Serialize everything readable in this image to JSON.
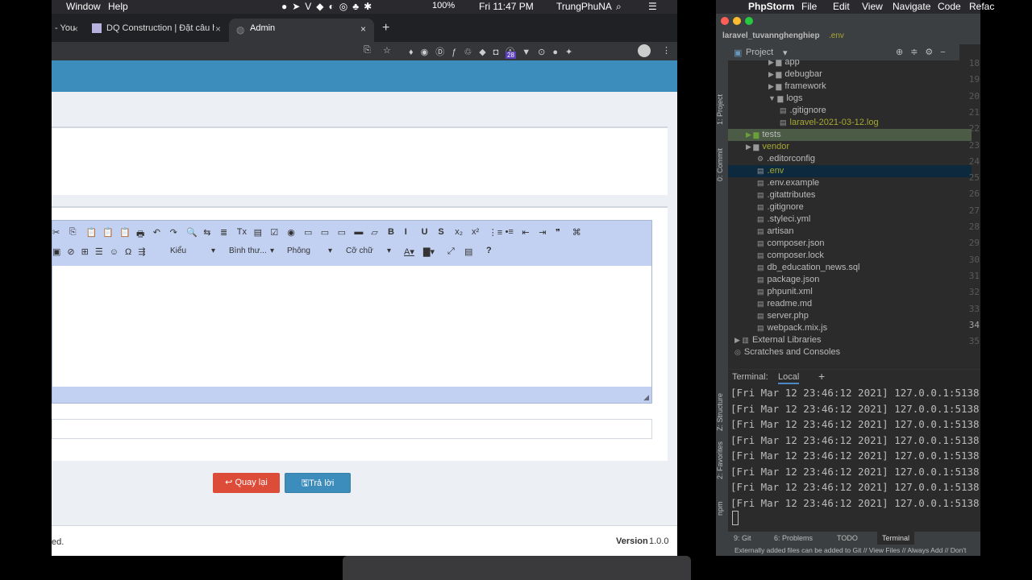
{
  "mac_menubar": {
    "items": [
      "Window",
      "Help"
    ],
    "battery": "100%",
    "clock": "Fri 11:47 PM",
    "user": "TrungPhuNA"
  },
  "browser": {
    "tabs": [
      {
        "label": "- You"
      },
      {
        "label": "DQ Construction | Đặt câu hỏi"
      },
      {
        "label": "Admin",
        "active": true
      }
    ],
    "extension_badge": "28",
    "header_color": "#3c8dbc",
    "editor": {
      "row1": [
        "✂",
        "⎘",
        "📋",
        "📋",
        "📋",
        "🖶",
        "↶",
        "↷",
        "🔍",
        "⇆",
        "≣",
        "Tx",
        "▤",
        "☑",
        "◉",
        "▭",
        "▭",
        "▭",
        "▬",
        "▱",
        "B",
        "I",
        "U",
        "S",
        "x₂",
        "x²",
        "⋮≡",
        "•≡",
        "⇤",
        "⇥",
        "❞",
        "⌘"
      ],
      "row2_icons": [
        "▣",
        "⊘",
        "⊞",
        "☰",
        "☺",
        "Ω",
        "⇶"
      ],
      "style_select": "Kiểu",
      "format_select": "Bình thư...",
      "font_select": "Phông",
      "size_select": "Cỡ chữ",
      "help": "?"
    },
    "buttons": {
      "back": "Quay lại",
      "reply": "Trả lời"
    },
    "footer": {
      "left": "ed.",
      "version_label": "Version",
      "version": "1.0.0"
    }
  },
  "phpstorm": {
    "menu": [
      "PhpStorm",
      "File",
      "Edit",
      "View",
      "Navigate",
      "Code",
      "Refac"
    ],
    "breadcrumb": [
      "laravel_tuvannghenghiep",
      ".env"
    ],
    "panel_title": "Project",
    "side_tabs": [
      "1: Project",
      "0: Commit",
      "Z: Structure",
      "2: Favorites",
      "npm"
    ],
    "tree": [
      {
        "label": "app",
        "indent": 3,
        "type": "folder"
      },
      {
        "label": "debugbar",
        "indent": 3,
        "type": "folder"
      },
      {
        "label": "framework",
        "indent": 3,
        "type": "folder"
      },
      {
        "label": "logs",
        "indent": 3,
        "type": "folder-open"
      },
      {
        "label": ".gitignore",
        "indent": 4,
        "type": "file"
      },
      {
        "label": "laravel-2021-03-12.log",
        "indent": 4,
        "type": "file",
        "color": "#a8a832"
      },
      {
        "label": "tests",
        "indent": 1,
        "type": "folder",
        "highlight": "#4b5b45"
      },
      {
        "label": "vendor",
        "indent": 1,
        "type": "folder",
        "color": "#a8a832"
      },
      {
        "label": ".editorconfig",
        "indent": 2,
        "type": "gear"
      },
      {
        "label": ".env",
        "indent": 2,
        "type": "file",
        "selected": true,
        "color": "#a8a832"
      },
      {
        "label": ".env.example",
        "indent": 2,
        "type": "file"
      },
      {
        "label": ".gitattributes",
        "indent": 2,
        "type": "file"
      },
      {
        "label": ".gitignore",
        "indent": 2,
        "type": "file"
      },
      {
        "label": ".styleci.yml",
        "indent": 2,
        "type": "file"
      },
      {
        "label": "artisan",
        "indent": 2,
        "type": "file"
      },
      {
        "label": "composer.json",
        "indent": 2,
        "type": "file"
      },
      {
        "label": "composer.lock",
        "indent": 2,
        "type": "file"
      },
      {
        "label": "db_education_news.sql",
        "indent": 2,
        "type": "file"
      },
      {
        "label": "package.json",
        "indent": 2,
        "type": "file"
      },
      {
        "label": "phpunit.xml",
        "indent": 2,
        "type": "file"
      },
      {
        "label": "readme.md",
        "indent": 2,
        "type": "file"
      },
      {
        "label": "server.php",
        "indent": 2,
        "type": "file"
      },
      {
        "label": "webpack.mix.js",
        "indent": 2,
        "type": "file"
      },
      {
        "label": "External Libraries",
        "indent": 0,
        "type": "lib"
      },
      {
        "label": "Scratches and Consoles",
        "indent": 0,
        "type": "scratch"
      }
    ],
    "line_numbers": [
      "18",
      "19",
      "20",
      "21",
      "22",
      "23",
      "24",
      "25",
      "26",
      "27",
      "28",
      "29",
      "30",
      "31",
      "32",
      "33",
      "34",
      "35"
    ],
    "terminal": {
      "title": "Terminal:",
      "tab": "Local",
      "lines": [
        "[Fri Mar 12 23:46:12 2021] 127.0.0.1:5138",
        "[Fri Mar 12 23:46:12 2021] 127.0.0.1:5138",
        "[Fri Mar 12 23:46:12 2021] 127.0.0.1:5138",
        "[Fri Mar 12 23:46:12 2021] 127.0.0.1:5138",
        "[Fri Mar 12 23:46:12 2021] 127.0.0.1:5138",
        "[Fri Mar 12 23:46:12 2021] 127.0.0.1:5138",
        "[Fri Mar 12 23:46:12 2021] 127.0.0.1:5138",
        "[Fri Mar 12 23:46:12 2021] 127.0.0.1:5138"
      ]
    },
    "bottom_tabs": [
      "9: Git",
      "6: Problems",
      "TODO",
      "Terminal"
    ],
    "status": "Externally added files can be added to Git // View Files // Always Add // Don't"
  }
}
